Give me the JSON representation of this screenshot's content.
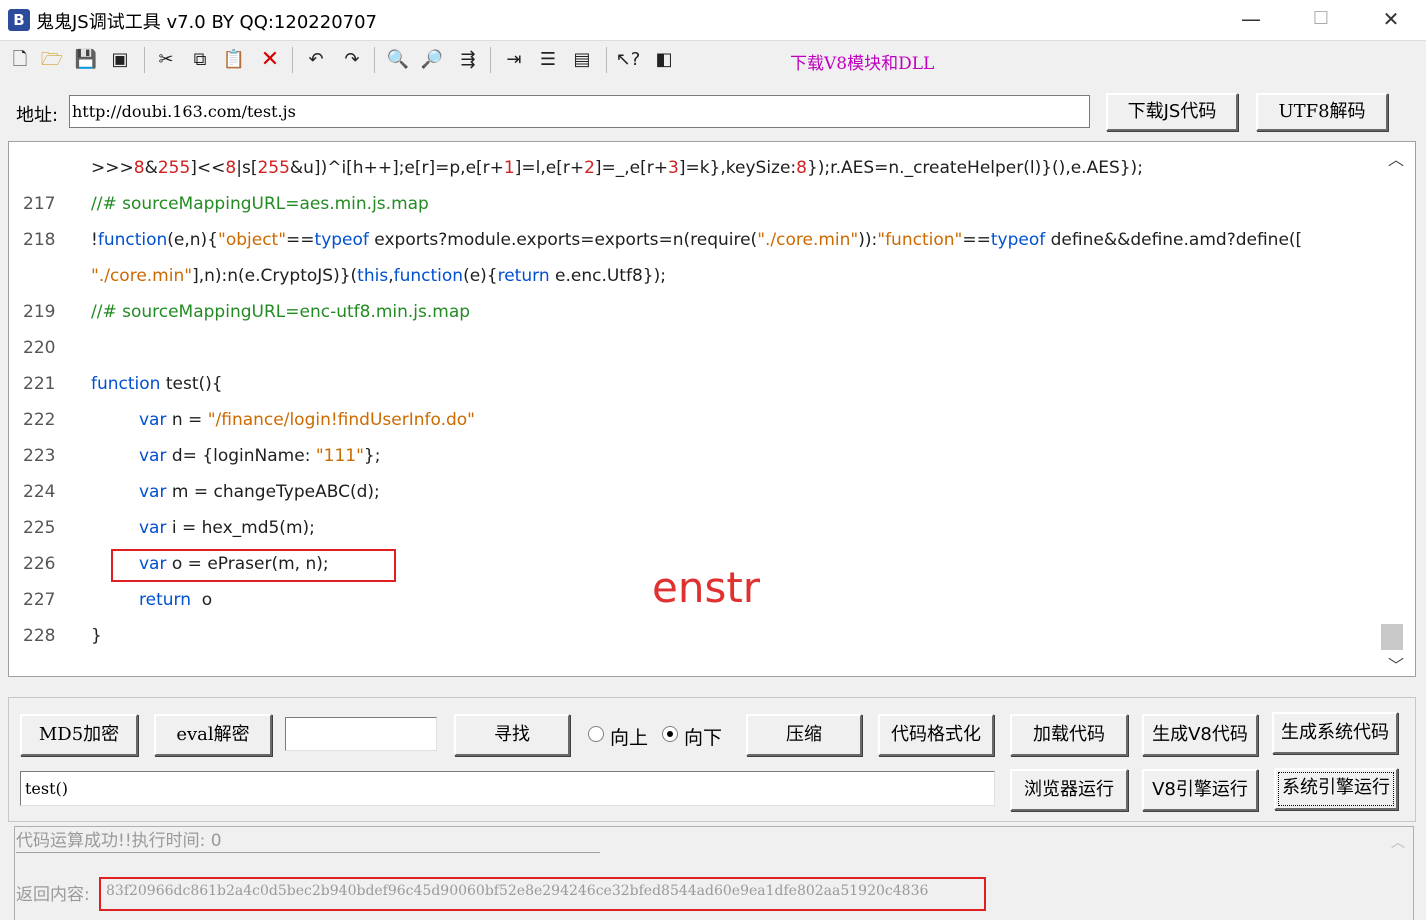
{
  "window": {
    "title": "鬼鬼JS调试工具 v7.0 BY QQ:120220707",
    "icon_letter": "B",
    "minimize": "—",
    "maximize": "☐",
    "close": "✕"
  },
  "toolbar": {
    "download_v8_link": "下载V8模块和DLL"
  },
  "address": {
    "label": "地址:",
    "value": "http://doubi.163.com/test.js",
    "download_js_button": "下载JS代码",
    "utf8_decode_button": "UTF8解码"
  },
  "editor": {
    "line_numbers": [
      "",
      "217",
      "218",
      "",
      "219",
      "220",
      "221",
      "222",
      "223",
      "224",
      "225",
      "226",
      "227",
      "228"
    ],
    "annotation": "enstr"
  },
  "controls": {
    "md5_button": "MD5加密",
    "eval_button": "eval解密",
    "search_value": "",
    "find_button": "寻找",
    "radio_up": "向上",
    "radio_down": "向下",
    "compress_button": "压缩",
    "format_button": "代码格式化",
    "load_button": "加载代码",
    "gen_v8_button": "生成V8代码",
    "gen_system_button": "生成系统代码",
    "command_value": "test()",
    "browser_run_button": "浏览器运行",
    "v8_run_button": "V8引擎运行",
    "system_run_button": "系统引擎运行"
  },
  "output": {
    "status": "代码运算成功!!执行时间: 0",
    "return_label": "返回内容:",
    "return_value": "83f20966dc861b2a4c0d5bec2b940bdef96c45d90060bf52e8e294246ce32bfed8544ad60e9ea1dfe802aa51920c4836"
  }
}
